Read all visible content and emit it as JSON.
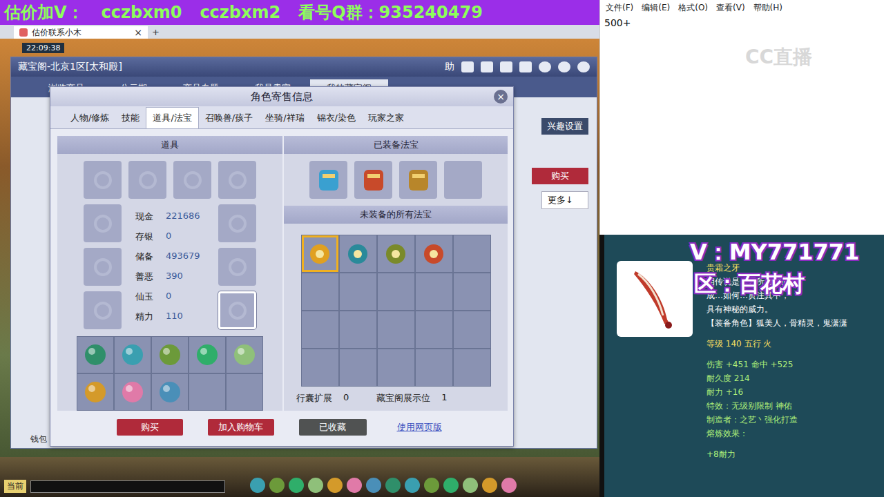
{
  "banner": {
    "parts": [
      "估价加V：",
      "cczbxm0",
      "cczbxm2",
      "看号Q群：935240479"
    ]
  },
  "browser_tab": {
    "title": "估价联系小木",
    "close": "×",
    "new_tab": "+"
  },
  "clock": "22:09:38",
  "main_window": {
    "title": "藏宝阁-北京1区[太和殿]",
    "controls": [
      "助"
    ],
    "tabs": [
      {
        "label": "浏览商品",
        "selected": false
      },
      {
        "label": "公示期",
        "selected": false
      },
      {
        "label": "商品专题",
        "selected": false
      },
      {
        "label": "我是卖家",
        "selected": false
      },
      {
        "label": "我的藏宝阁",
        "selected": true
      }
    ],
    "side_buttons": [
      {
        "label": "兴趣设置",
        "kind": "dark"
      },
      {
        "label": "购买",
        "kind": "red"
      },
      {
        "label": "更多↓",
        "kind": "light"
      }
    ],
    "footer": "钱包"
  },
  "dialog": {
    "title": "角色寄售信息",
    "close": "×",
    "tabs": [
      {
        "label": "人物/修炼",
        "selected": false
      },
      {
        "label": "技能",
        "selected": false
      },
      {
        "label": "道具/法宝",
        "selected": true
      },
      {
        "label": "召唤兽/孩子",
        "selected": false
      },
      {
        "label": "坐骑/祥瑞",
        "selected": false
      },
      {
        "label": "锦衣/染色",
        "selected": false
      },
      {
        "label": "玩家之家",
        "selected": false
      }
    ],
    "items_title": "道具",
    "equip_slots": [
      {
        "selected": false
      },
      {
        "selected": false
      },
      {
        "selected": false
      },
      {
        "selected": false
      },
      {
        "selected": false
      },
      {
        "selected": false
      },
      {
        "selected": false
      },
      {
        "selected": false
      },
      {
        "selected": false
      },
      {
        "selected": true
      }
    ],
    "stats": [
      {
        "label": "现金",
        "value": "221686"
      },
      {
        "label": "存银",
        "value": "0"
      },
      {
        "label": "储备",
        "value": "493679"
      },
      {
        "label": "善恶",
        "value": "390"
      },
      {
        "label": "仙玉",
        "value": "0"
      },
      {
        "label": "精力",
        "value": "110"
      }
    ],
    "bag": [
      {
        "filled": true
      },
      {
        "filled": true
      },
      {
        "filled": true
      },
      {
        "filled": true
      },
      {
        "filled": true
      },
      {
        "filled": true
      },
      {
        "filled": true
      },
      {
        "filled": true
      },
      {
        "filled": false
      },
      {
        "filled": false
      }
    ],
    "equipped_title": "已装备法宝",
    "equipped": [
      {
        "filled": true
      },
      {
        "filled": true
      },
      {
        "filled": true
      },
      {
        "filled": false
      }
    ],
    "unequipped_title": "未装备的所有法宝",
    "unequipped": [
      {
        "filled": true,
        "selected": true
      },
      {
        "filled": true,
        "selected": false
      },
      {
        "filled": true,
        "selected": false
      },
      {
        "filled": true,
        "selected": false
      },
      {
        "filled": false,
        "selected": false
      },
      {
        "filled": false,
        "selected": false
      },
      {
        "filled": false,
        "selected": false
      },
      {
        "filled": false,
        "selected": false
      },
      {
        "filled": false,
        "selected": false
      },
      {
        "filled": false,
        "selected": false
      },
      {
        "filled": false,
        "selected": false
      },
      {
        "filled": false,
        "selected": false
      },
      {
        "filled": false,
        "selected": false
      },
      {
        "filled": false,
        "selected": false
      },
      {
        "filled": false,
        "selected": false
      },
      {
        "filled": false,
        "selected": false
      },
      {
        "filled": false,
        "selected": false
      },
      {
        "filled": false,
        "selected": false
      },
      {
        "filled": false,
        "selected": false
      },
      {
        "filled": false,
        "selected": false
      }
    ],
    "footer_stats": [
      {
        "label": "行囊扩展",
        "value": "0"
      },
      {
        "label": "藏宝阁展示位",
        "value": "1"
      }
    ],
    "buttons": [
      {
        "label": "购买",
        "kind": "red"
      },
      {
        "label": "加入购物车",
        "kind": "red"
      },
      {
        "label": "已收藏",
        "kind": "dark"
      },
      {
        "label": "使用网页版",
        "kind": "link"
      }
    ]
  },
  "notepad": {
    "menu": [
      "文件(F)",
      "编辑(E)",
      "格式(O)",
      "查看(V)",
      "帮助(H)"
    ],
    "content": "500+",
    "watermark": "CC直播"
  },
  "tooltip": {
    "contact": "V：MY771771",
    "region": "区：百花村",
    "lines": [
      {
        "text": "贵霜之牙",
        "kind": "name"
      },
      {
        "text": "相传说是…牙所雕刻而",
        "kind": "desc"
      },
      {
        "text": "成…如何…贯注其中，",
        "kind": "desc"
      },
      {
        "text": "具有神秘的威力。",
        "kind": "desc"
      },
      {
        "text": "【装备角色】狐美人，骨精灵，鬼潇潇",
        "kind": "desc"
      },
      {
        "text": "",
        "kind": "gap"
      },
      {
        "text": "等级 140 五行 火",
        "kind": "info"
      },
      {
        "text": "",
        "kind": "gap"
      },
      {
        "text": "伤害 +451 命中 +525",
        "kind": "attr"
      },
      {
        "text": "耐久度 214",
        "kind": "attr"
      },
      {
        "text": "耐力 +16",
        "kind": "attr"
      },
      {
        "text": "特效：无级别限制 神佑",
        "kind": "attr"
      },
      {
        "text": "制造者：之艺丶强化打造",
        "kind": "attr"
      },
      {
        "text": "熔炼效果：",
        "kind": "attr"
      },
      {
        "text": "",
        "kind": "gap"
      },
      {
        "text": "+8耐力",
        "kind": "attr"
      }
    ]
  },
  "toolbar": {
    "channel": "当前"
  }
}
